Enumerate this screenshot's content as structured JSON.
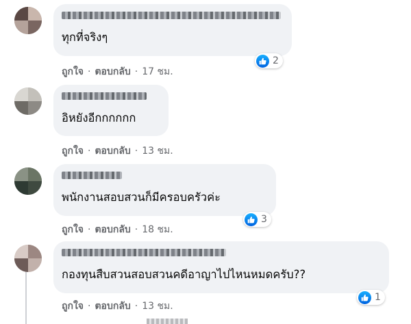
{
  "comments": [
    {
      "text": "ทุกที่จริงๆ",
      "like": "ถูกใจ",
      "reply": "ตอบกลับ",
      "time": "17 ชม.",
      "reactions": "2",
      "avatar_colors": [
        "#8a7a73",
        "#5a4844",
        "#c9b6ac"
      ]
    },
    {
      "text": "อิหยังอีกกกกกก",
      "like": "ถูกใจ",
      "reply": "ตอบกลับ",
      "time": "13 ชม.",
      "reactions": "",
      "avatar_colors": [
        "#a8a9a6",
        "#6e6b66",
        "#d9d7d2"
      ]
    },
    {
      "text": "พนักงานสอบสวนก็มีครอบครัวค่ะ",
      "like": "ถูกใจ",
      "reply": "ตอบกลับ",
      "time": "18 ชม.",
      "reactions": "3",
      "avatar_colors": [
        "#4f5a4a",
        "#2e3a33",
        "#8a9285"
      ]
    },
    {
      "text": "กองทุนสืบสวนสอบสวนคดีอาญาไปไหนหมดครับ??",
      "like": "ถูกใจ",
      "reply": "ตอบกลับ",
      "time": "13 ชม.",
      "reactions": "1",
      "avatar_colors": [
        "#b09a93",
        "#6d5b58",
        "#d8cbc6"
      ]
    }
  ],
  "colors": {
    "bubble": "#f0f2f5",
    "meta_text": "#65676b",
    "like_blue": "#1877f2"
  },
  "icons": {
    "like": "like-thumb-icon"
  }
}
